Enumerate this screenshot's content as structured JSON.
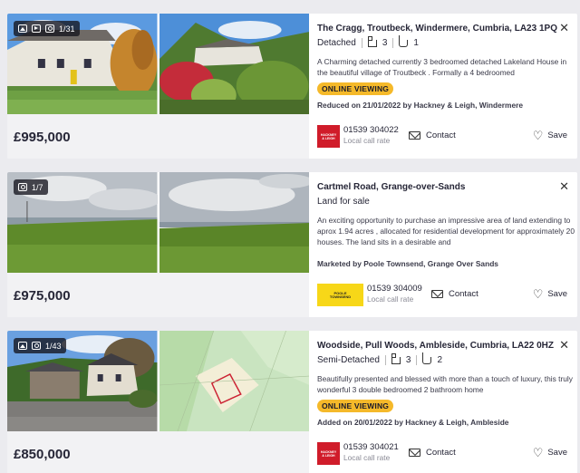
{
  "listings": [
    {
      "photo_count": "1/31",
      "price": "£995,000",
      "title": "The Cragg, Troutbeck, Windermere, Cumbria, LA23 1PQ",
      "property_type": "Detached",
      "bedrooms": "3",
      "bathrooms": "1",
      "description": "A Charming detached currently 3 bedroomed detached Lakeland House in the beautiful village of Troutbeck . Formally a 4 bedroomed",
      "tag": "ONLINE VIEWING",
      "status_line": "Reduced on 21/01/2022 by Hackney & Leigh, Windermere",
      "phone": "01539 304022",
      "phone_note": "Local call rate",
      "contact_label": "Contact",
      "save_label": "Save",
      "agent_logo_text": [
        "HACKNEY",
        "& LEIGH"
      ]
    },
    {
      "photo_count": "1/7",
      "price": "£975,000",
      "title": "Cartmel Road, Grange-over-Sands",
      "property_type": "Land for sale",
      "description": "An exciting opportunity to purchase an impressive area of land extending to aprox 1.94 acres , allocated for residential development for approximately 20 houses. The land sits in a desirable and",
      "status_line": "Marketed by Poole Townsend, Grange Over Sands",
      "phone": "01539 304009",
      "phone_note": "Local call rate",
      "contact_label": "Contact",
      "save_label": "Save",
      "agent_logo_text": [
        "POOLE",
        "TOWNSEND"
      ]
    },
    {
      "photo_count": "1/43",
      "price": "£850,000",
      "title": "Woodside, Pull Woods, Ambleside, Cumbria, LA22 0HZ",
      "property_type": "Semi-Detached",
      "bedrooms": "3",
      "bathrooms": "2",
      "description": "Beautifully presented and blessed with more than a touch of luxury, this truly wonderful 3 double bedroomed 2 bathroom home",
      "tag": "ONLINE VIEWING",
      "status_line": "Added on 20/01/2022 by Hackney & Leigh, Ambleside",
      "phone": "01539 304021",
      "phone_note": "Local call rate",
      "contact_label": "Contact",
      "save_label": "Save",
      "agent_logo_text": [
        "HACKNEY",
        "& LEIGH"
      ]
    }
  ],
  "icons": {
    "close": "close-icon",
    "envelope": "envelope-icon",
    "heart": "heart-icon",
    "camera": "camera-icon",
    "bed": "bed-icon",
    "bath": "bath-icon"
  },
  "colors": {
    "tag_bg": "#f5b92a",
    "hackney_red": "#d01c2a",
    "poole_yellow": "#f7d718"
  }
}
